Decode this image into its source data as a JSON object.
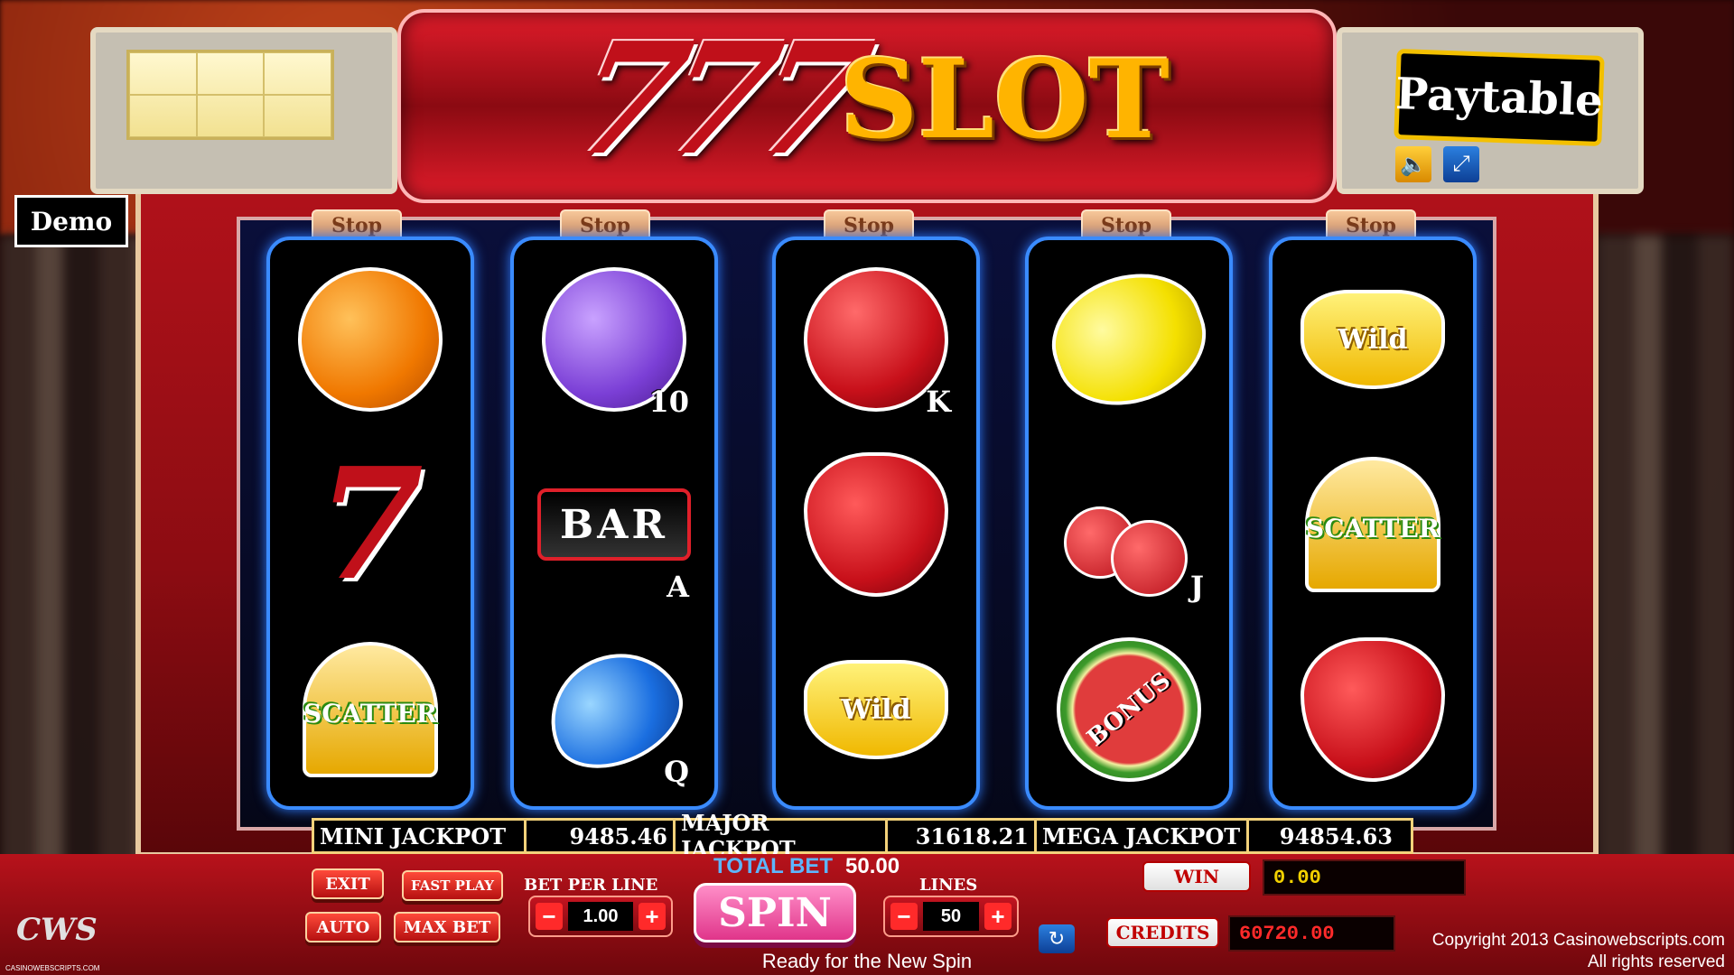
{
  "header": {
    "logo_number": "777",
    "logo_word": "SLOT",
    "demo_label": "Demo",
    "paytable_label": "Paytable",
    "sound_icon": "speaker-icon",
    "fullscreen_icon": "fullscreen-icon"
  },
  "stop_buttons": [
    "Stop",
    "Stop",
    "Stop",
    "Stop",
    "Stop"
  ],
  "reels": [
    [
      {
        "symbol": "orange",
        "label": ""
      },
      {
        "symbol": "seven",
        "label": ""
      },
      {
        "symbol": "bell",
        "label": "SCATTER"
      }
    ],
    [
      {
        "symbol": "grapes",
        "label": "10"
      },
      {
        "symbol": "bar",
        "label": "A",
        "text": "BAR"
      },
      {
        "symbol": "plum",
        "label": "Q"
      }
    ],
    [
      {
        "symbol": "apple",
        "label": "K"
      },
      {
        "symbol": "strawberry",
        "label": ""
      },
      {
        "symbol": "banana",
        "label": "Wild"
      }
    ],
    [
      {
        "symbol": "lemon",
        "label": ""
      },
      {
        "symbol": "cherries",
        "label": "J"
      },
      {
        "symbol": "watermelon",
        "label": "BONUS"
      }
    ],
    [
      {
        "symbol": "banana",
        "label": "Wild"
      },
      {
        "symbol": "bell",
        "label": "SCATTER"
      },
      {
        "symbol": "strawberry",
        "label": ""
      }
    ]
  ],
  "jackpots": {
    "mini_label": "MINI JACKPOT",
    "mini_value": "9485.46",
    "major_label": "MAJOR JACKPOT",
    "major_value": "31618.21",
    "mega_label": "MEGA JACKPOT",
    "mega_value": "94854.63"
  },
  "controls": {
    "exit_label": "EXIT",
    "fast_play_label": "FAST PLAY",
    "auto_label": "AUTO",
    "max_bet_label": "MAX BET",
    "bet_per_line_label": "BET PER LINE",
    "bet_per_line_value": "1.00",
    "total_bet_label": "TOTAL BET",
    "total_bet_value": "50.00",
    "spin_label": "SPIN",
    "lines_label": "LINES",
    "lines_value": "50",
    "status_text": "Ready for the New Spin",
    "refresh_icon": "refresh-icon",
    "win_label": "WIN",
    "win_value": "0.00",
    "credits_label": "CREDITS",
    "credits_value": "60720.00"
  },
  "footer": {
    "cws_logo": "CWS",
    "cws_small": "CASINOWEBSCRIPTS.COM",
    "copyright_line1": "Copyright 2013 Casinowebscripts.com",
    "copyright_line2": "All rights reserved"
  },
  "colors": {
    "cabinet_red": "#b5121b",
    "reel_border_blue": "#3a8bff",
    "spin_pink": "#e0358a",
    "slot_gold": "#ffb400"
  }
}
